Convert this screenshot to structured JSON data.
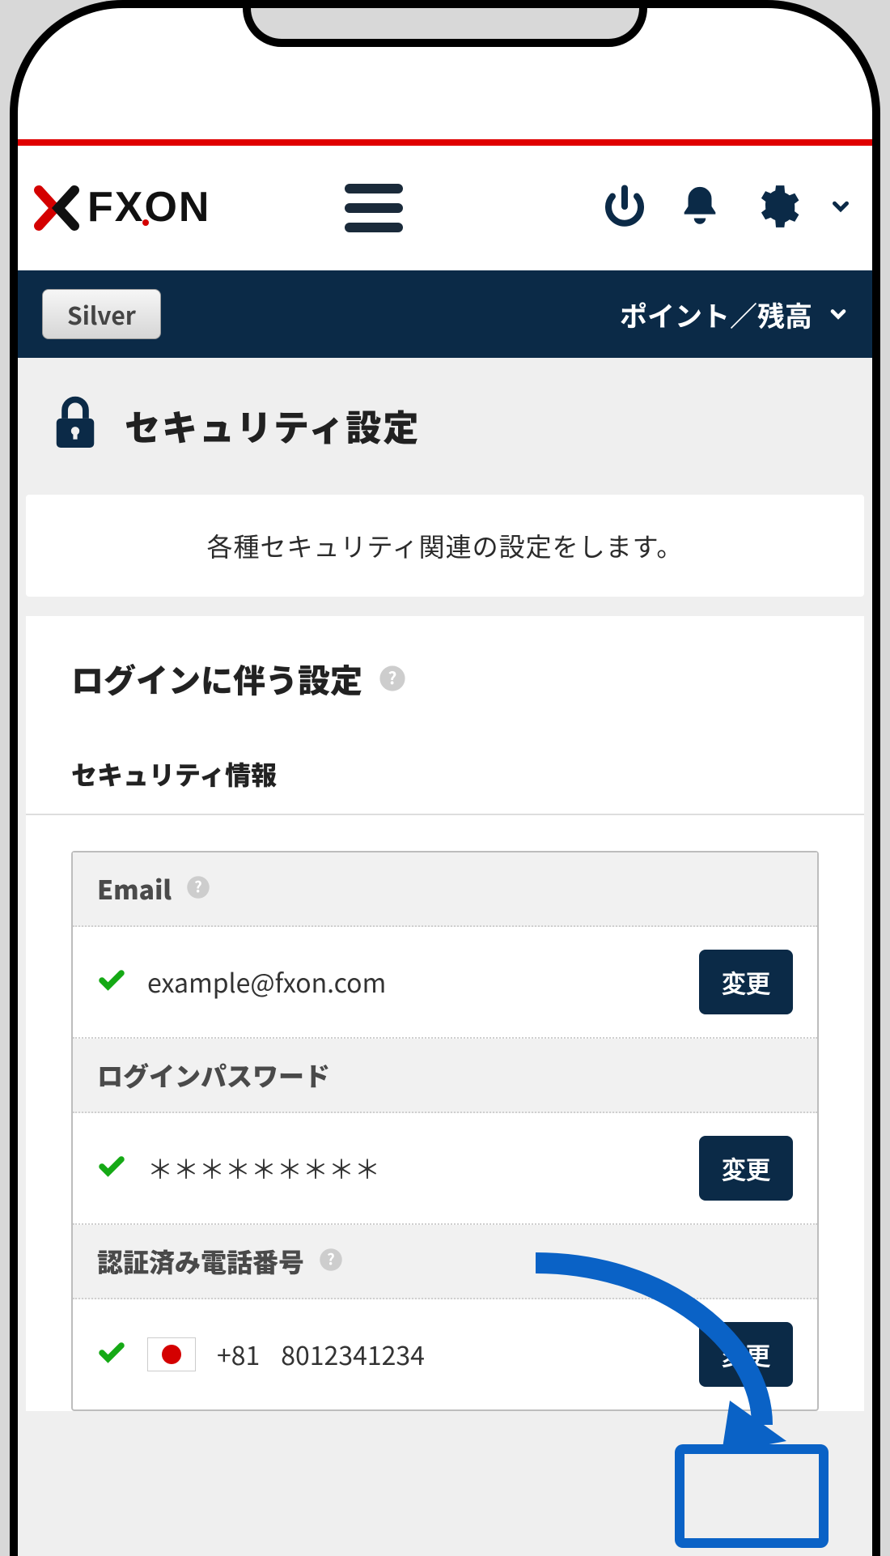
{
  "brand": {
    "name": "FXON"
  },
  "statusbar": {
    "tier": "Silver",
    "points_label": "ポイント／残高"
  },
  "page": {
    "title": "セキュリティ設定",
    "intro": "各種セキュリティ関連の設定をします。"
  },
  "login_section": {
    "heading": "ログインに伴う設定",
    "sub_heading": "セキュリティ情報"
  },
  "fields": {
    "email": {
      "label": "Email",
      "value": "example@fxon.com",
      "change_btn": "変更"
    },
    "password": {
      "label": "ログインパスワード",
      "value": "＊＊＊＊＊＊＊＊＊",
      "change_btn": "変更"
    },
    "phone": {
      "label": "認証済み電話番号",
      "code": "+81",
      "number": "8012341234",
      "change_btn": "変更"
    }
  }
}
